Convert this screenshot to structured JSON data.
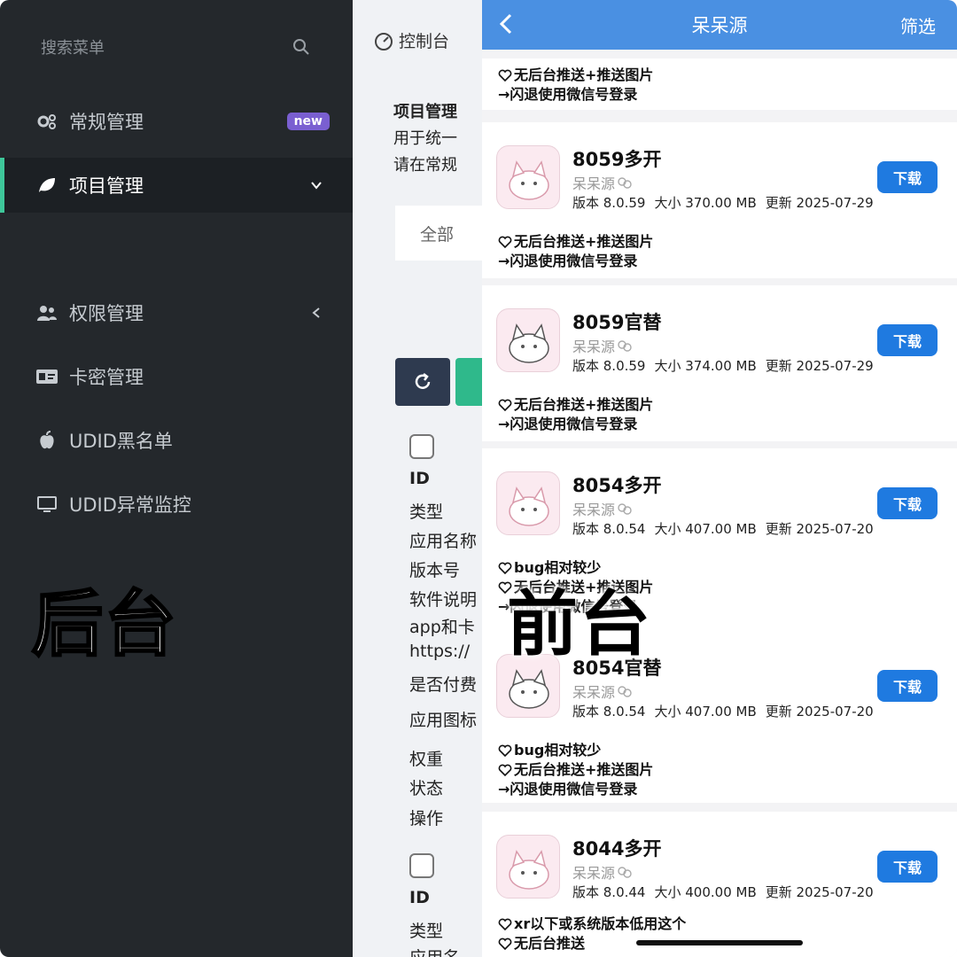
{
  "admin": {
    "search_placeholder": "搜索菜单",
    "menu": [
      {
        "label": "常规管理",
        "badge": "new"
      },
      {
        "label": "项目管理"
      },
      {
        "label": "权限管理"
      },
      {
        "label": "卡密管理"
      },
      {
        "label": "UDID黑名单"
      },
      {
        "label": "UDID异常监控"
      }
    ],
    "overlay_label": "后台"
  },
  "middle": {
    "breadcrumb": "控制台",
    "desc_title": "项目管理",
    "desc_line1": "用于统一",
    "desc_line2": "请在常规",
    "filter_chip": "全部",
    "fields_a": [
      "ID",
      "类型",
      "应用名称",
      "版本号",
      "软件说明",
      "app和卡",
      "https://",
      "是否付费",
      "应用图标",
      "权重",
      "状态",
      "操作"
    ],
    "fields_b": [
      "ID",
      "类型",
      "应用名"
    ]
  },
  "front": {
    "nav_title": "呆呆源",
    "nav_filter": "筛选",
    "top_notes": [
      "无后台推送+推送图片",
      "闪退使用微信号登录"
    ],
    "apps": [
      {
        "name": "8059多开",
        "source": "呆呆源",
        "version": "版本 8.0.59",
        "size": "大小 370.00 MB",
        "updated": "更新 2025-07-29",
        "download": "下载",
        "notes": [
          "无后台推送+推送图片",
          "闪退使用微信号登录"
        ]
      },
      {
        "name": "8059官替",
        "source": "呆呆源",
        "version": "版本 8.0.59",
        "size": "大小 374.00 MB",
        "updated": "更新 2025-07-29",
        "download": "下载",
        "notes": [
          "无后台推送+推送图片",
          "闪退使用微信号登录"
        ]
      },
      {
        "name": "8054多开",
        "source": "呆呆源",
        "version": "版本 8.0.54",
        "size": "大小 407.00 MB",
        "updated": "更新 2025-07-20",
        "download": "下载",
        "notes": [
          "bug相对较少",
          "无后台推送+推送图片",
          "闪退使用微信号登录"
        ]
      },
      {
        "name": "8054官替",
        "source": "呆呆源",
        "version": "版本 8.0.54",
        "size": "大小 407.00 MB",
        "updated": "更新 2025-07-20",
        "download": "下载",
        "notes": [
          "bug相对较少",
          "无后台推送+推送图片",
          "闪退使用微信号登录"
        ]
      },
      {
        "name": "8044多开",
        "source": "呆呆源",
        "version": "版本 8.0.44",
        "size": "大小 400.00 MB",
        "updated": "更新 2025-07-20",
        "download": "下载",
        "notes": [
          "xr以下或系统版本低用这个",
          "无后台推送"
        ]
      }
    ],
    "overlay_label": "前台"
  },
  "colors": {
    "admin_bg": "#24282c",
    "accent_green": "#3ec79a",
    "nav_blue": "#4a90e2",
    "download_blue": "#1f7ae0",
    "new_badge": "#7a5fd1"
  }
}
